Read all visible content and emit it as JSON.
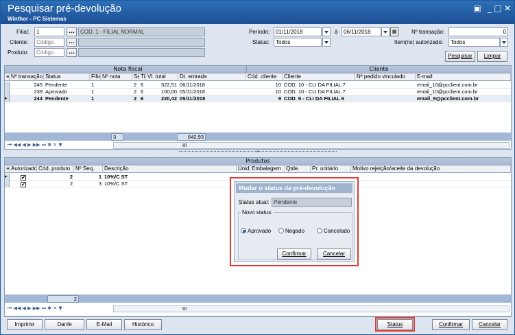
{
  "window": {
    "title": "Pesquisar pré-devolução",
    "subtitle": "Winthor - PC Sistemas",
    "controls": [
      "▣",
      "_",
      "□",
      "✕"
    ]
  },
  "filters": {
    "filial_label": "Filial:",
    "filial_value": "1",
    "filial_desc": "COD. 1 - FILIAL NORMAL",
    "cliente_label": "Cliente:",
    "cliente_placeholder": "Código",
    "produto_label": "Produto:",
    "produto_placeholder": "Código",
    "periodo_label": "Período:",
    "periodo_from": "01/11/2018",
    "periodo_sep": "à",
    "periodo_to": "06/11/2018",
    "status_label": "Status:",
    "status_value": "Todos",
    "ntrans_label": "Nº transação:",
    "ntrans_value": "0",
    "itens_label": "Item(ns) autorizado:",
    "itens_value": "Todos",
    "pesquisar_button": "Pesquisar",
    "limpar_button": "Limpar"
  },
  "upper_grid": {
    "group_nota": "Nota fiscal",
    "group_cliente": "Cliente",
    "columns": [
      "Nº transação",
      "Status",
      "Filial",
      "Nº nota",
      "Série",
      "Tipo",
      "Vl. total",
      "Dt. entrada",
      "Cód. cliente",
      "Cliente",
      "Nº pedido vinculado",
      "E-mail"
    ],
    "rows": [
      [
        "245",
        "Pendente",
        "1",
        "",
        "2",
        "6",
        "322,51",
        "06/11/2018",
        "10",
        "COD. 10 - CLI DA FILIAL 7",
        "",
        "email_10@pcclient.com.br"
      ],
      [
        "239",
        "Aprovado",
        "1",
        "",
        "2",
        "6",
        "100,00",
        "05/11/2018",
        "10",
        "COD. 10 - CLI DA FILIAL 7",
        "",
        "email_10@pcclient.com.br"
      ],
      [
        "244",
        "Pendente",
        "1",
        "",
        "2",
        "6",
        "220,42",
        "05/11/2018",
        "9",
        "COD. 9 - CLI DA FILIAL 6",
        "",
        "email_9@pcclient.com.br"
      ]
    ],
    "footer_count": "3",
    "footer_total": "642,93",
    "scroll_mark": "III",
    "splitter": "^"
  },
  "lower_grid": {
    "group_produtos": "Produtos",
    "columns": [
      "Autorizado",
      "Cód. produto",
      "Nº Seq.",
      "Descrição",
      "Unid.",
      "Embalagem",
      "Qtde.",
      "Pr. unitário",
      "Motivo rejeição/aceite da devolução"
    ],
    "rows": [
      [
        "✔",
        "2",
        "1",
        "10%/C ST"
      ],
      [
        "✔",
        "2",
        "3",
        "10%/C ST"
      ]
    ],
    "footer_count": "2",
    "scroll_mark": "III"
  },
  "dialog": {
    "title": "Mudar o status da pré-devolução",
    "status_atual_label": "Status atual:",
    "status_atual_value": "Pendente",
    "novo_status_label": "Novo status:",
    "opt_aprovado": "Aprovado",
    "opt_negado": "Negado",
    "opt_cancelado": "Cancelado",
    "confirmar": "Confirmar",
    "cancelar": "Cancelar"
  },
  "bottom": {
    "imprimir": "Imprimir",
    "danfe": "Danfe",
    "email": "E-Mail",
    "historico": "Histórico",
    "status": "Status",
    "confirmar": "Confirmar",
    "cancelar": "Cancelar"
  },
  "nav_symbols": {
    "upper": "⏮ ◀◀ ◀ ▶ ▶▶ ⏭ ✱ ✕ ▼",
    "lower": "⏮ ◀◀ ◀ ▶ ▶▶ ⏭ ✱ ✕ ▼"
  },
  "colors": {
    "title_bar": "#1c5096",
    "highlight": "#e23a35",
    "selected_row": "#e7edf5"
  }
}
